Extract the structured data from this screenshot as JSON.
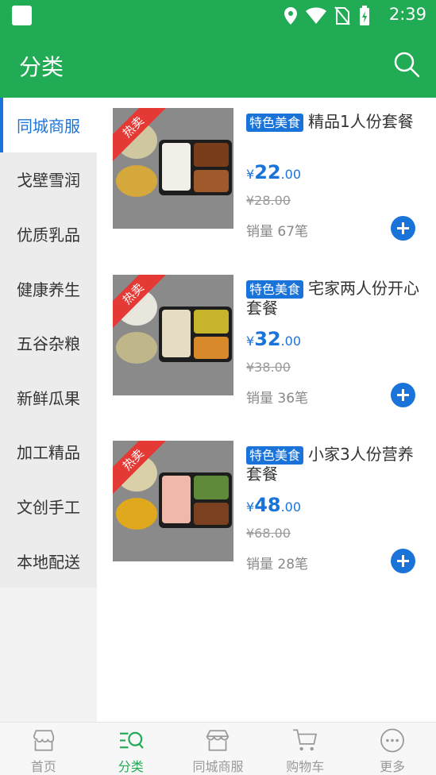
{
  "status_bar": {
    "time": "2:39"
  },
  "header": {
    "title": "分类"
  },
  "sidebar": {
    "items": [
      {
        "label": "同城商服",
        "active": true
      },
      {
        "label": "戈壁雪润"
      },
      {
        "label": "优质乳品"
      },
      {
        "label": "健康养生"
      },
      {
        "label": "五谷杂粮"
      },
      {
        "label": "新鲜瓜果"
      },
      {
        "label": "加工精品"
      },
      {
        "label": "文创手工"
      },
      {
        "label": "本地配送"
      }
    ]
  },
  "products": [
    {
      "badge": "热卖",
      "tag": "特色美食",
      "name": "精品1人份套餐",
      "currency": "¥",
      "price_int": "22",
      "price_dec": ".00",
      "old_price": "¥28.00",
      "sales": "销量 67笔"
    },
    {
      "badge": "热卖",
      "tag": "特色美食",
      "name": "宅家两人份开心套餐",
      "currency": "¥",
      "price_int": "32",
      "price_dec": ".00",
      "old_price": "¥38.00",
      "sales": "销量 36笔"
    },
    {
      "badge": "热卖",
      "tag": "特色美食",
      "name": "小家3人份营养套餐",
      "currency": "¥",
      "price_int": "48",
      "price_dec": ".00",
      "old_price": "¥68.00",
      "sales": "销量 28笔"
    }
  ],
  "bottom_nav": [
    {
      "label": "首页",
      "icon": "shop-icon"
    },
    {
      "label": "分类",
      "icon": "category-search-icon",
      "active": true
    },
    {
      "label": "同城商服",
      "icon": "store-icon"
    },
    {
      "label": "购物车",
      "icon": "cart-icon"
    },
    {
      "label": "更多",
      "icon": "more-icon"
    }
  ],
  "colors": {
    "primary_green": "#22ab55",
    "accent_blue": "#1a73d9",
    "badge_red": "#e53935"
  }
}
